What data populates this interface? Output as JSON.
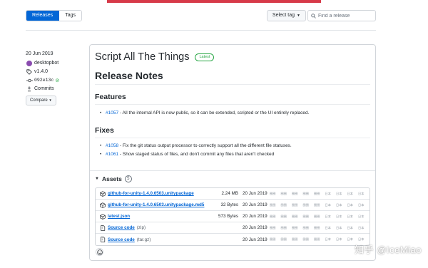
{
  "colors": {
    "accent": "#0366d6",
    "success": "#28a745",
    "stripe": "#d73a49"
  },
  "toolbar": {
    "tabs": [
      "Releases",
      "Tags"
    ],
    "select_tag_label": "Select tag",
    "search_placeholder": "Find a release"
  },
  "sidebar": {
    "date": "20 Jun 2019",
    "author": "desktopbot",
    "tag": "v1.4.0",
    "commit": "092e13c",
    "commits_label": "Commits",
    "compare_label": "Compare"
  },
  "release": {
    "title": "Script All The Things",
    "badge": "Latest",
    "notes_heading": "Release Notes",
    "features_heading": "Features",
    "features": [
      {
        "ref": "#1057",
        "text": " - All the internal API is now public, so it can be extended, scripted or the UI entirely replaced."
      }
    ],
    "fixes_heading": "Fixes",
    "fixes": [
      {
        "ref": "#1058",
        "text": " - Fix the git status output processor to correctly support all the different file statuses."
      },
      {
        "ref": "#1061",
        "text": " - Show staged status of files, and don't commit any files that aren't checked"
      }
    ]
  },
  "assets": {
    "heading": "Assets",
    "count": "5",
    "items": [
      {
        "icon": "package-icon",
        "name": "github-for-unity-1.4.0.6503.unitypackage",
        "suffix": "",
        "size": "2.24 MB",
        "date": "20 Jun 2019"
      },
      {
        "icon": "package-icon",
        "name": "github-for-unity-1.4.0.6503.unitypackage.md5",
        "suffix": "",
        "size": "32 Bytes",
        "date": "20 Jun 2019"
      },
      {
        "icon": "package-icon",
        "name": "latest.json",
        "suffix": "",
        "size": "573 Bytes",
        "date": "20 Jun 2019"
      },
      {
        "icon": "file-zip-icon",
        "name": "Source code",
        "suffix": "(zip)",
        "size": "",
        "date": "20 Jun 2019"
      },
      {
        "icon": "file-zip-icon",
        "name": "Source code",
        "suffix": "(tar.gz)",
        "size": "",
        "date": "20 Jun 2019"
      }
    ],
    "count_labels": [
      "圈圈",
      "圈圈",
      "圈圈",
      "圈圈",
      "圈圈",
      "日本",
      "日本",
      "日本",
      "日本"
    ]
  },
  "watermark": "知乎 @IceMiao"
}
